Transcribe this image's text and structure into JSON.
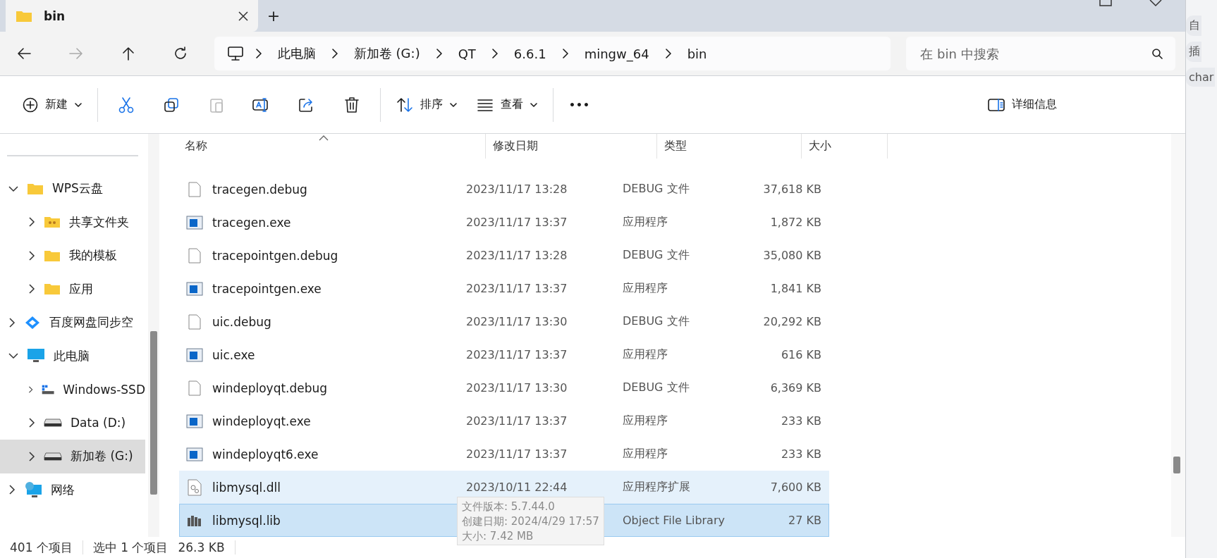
{
  "tabs": [
    {
      "title": "bin",
      "selected": true
    }
  ],
  "new_tab": "+",
  "breadcrumb": [
    "此电脑",
    "新加卷 (G:)",
    "QT",
    "6.6.1",
    "mingw_64",
    "bin"
  ],
  "search": {
    "placeholder": "在 bin 中搜索"
  },
  "toolbar": {
    "new": "新建",
    "sort": "排序",
    "view": "查看",
    "more": "•••",
    "details": "详细信息"
  },
  "sidebar": {
    "items": [
      {
        "label": "WPS云盘",
        "kind": "folder",
        "expanded": true,
        "selected": false,
        "children": [
          {
            "label": "共享文件夹",
            "kind": "shared",
            "expanded": false,
            "selected": false
          },
          {
            "label": "我的模板",
            "kind": "folder",
            "expanded": false,
            "selected": false
          },
          {
            "label": "应用",
            "kind": "folder",
            "expanded": false,
            "selected": false
          }
        ]
      },
      {
        "label": "百度网盘同步空",
        "kind": "cloud",
        "expanded": false,
        "selected": false
      },
      {
        "label": "此电脑",
        "kind": "pc",
        "expanded": true,
        "selected": false,
        "children": [
          {
            "label": "Windows-SSD",
            "kind": "windrive",
            "expanded": false,
            "selected": false
          },
          {
            "label": "Data (D:)",
            "kind": "drive",
            "expanded": false,
            "selected": false
          },
          {
            "label": "新加卷 (G:)",
            "kind": "drive",
            "expanded": false,
            "selected": true
          }
        ]
      },
      {
        "label": "网络",
        "kind": "network",
        "expanded": false,
        "selected": false
      }
    ]
  },
  "table": {
    "columns": [
      "名称",
      "修改日期",
      "类型",
      "大小"
    ],
    "rows": [
      {
        "name": "tracegen.debug",
        "kind": "debug",
        "date": "2023/11/17 13:28",
        "type": "DEBUG 文件",
        "size": "37,618 KB",
        "selected": false,
        "hovered": false
      },
      {
        "name": "tracegen.exe",
        "kind": "exe",
        "date": "2023/11/17 13:37",
        "type": "应用程序",
        "size": "1,872 KB",
        "selected": false,
        "hovered": false
      },
      {
        "name": "tracepointgen.debug",
        "kind": "debug",
        "date": "2023/11/17 13:28",
        "type": "DEBUG 文件",
        "size": "35,080 KB",
        "selected": false,
        "hovered": false
      },
      {
        "name": "tracepointgen.exe",
        "kind": "exe",
        "date": "2023/11/17 13:37",
        "type": "应用程序",
        "size": "1,841 KB",
        "selected": false,
        "hovered": false
      },
      {
        "name": "uic.debug",
        "kind": "debug",
        "date": "2023/11/17 13:30",
        "type": "DEBUG 文件",
        "size": "20,292 KB",
        "selected": false,
        "hovered": false
      },
      {
        "name": "uic.exe",
        "kind": "exe",
        "date": "2023/11/17 13:37",
        "type": "应用程序",
        "size": "616 KB",
        "selected": false,
        "hovered": false
      },
      {
        "name": "windeployqt.debug",
        "kind": "debug",
        "date": "2023/11/17 13:30",
        "type": "DEBUG 文件",
        "size": "6,369 KB",
        "selected": false,
        "hovered": false
      },
      {
        "name": "windeployqt.exe",
        "kind": "exe",
        "date": "2023/11/17 13:37",
        "type": "应用程序",
        "size": "233 KB",
        "selected": false,
        "hovered": false
      },
      {
        "name": "windeployqt6.exe",
        "kind": "exe",
        "date": "2023/11/17 13:37",
        "type": "应用程序",
        "size": "233 KB",
        "selected": false,
        "hovered": false
      },
      {
        "name": "libmysql.dll",
        "kind": "dll",
        "date": "2023/10/11 22:44",
        "type": "应用程序扩展",
        "size": "7,600 KB",
        "selected": false,
        "hovered": true
      },
      {
        "name": "libmysql.lib",
        "kind": "lib",
        "type": "Object File Library",
        "size": "27 KB",
        "selected": true,
        "hovered": false
      }
    ]
  },
  "tooltip": [
    "文件版本: 5.7.44.0",
    "创建日期: 2024/4/29 17:57",
    "大小: 7.42 MB"
  ],
  "status_bar": {
    "count": "401 个项目",
    "selection": "选中 1 个项目",
    "selection_size": "26.3 KB"
  },
  "background_window": {
    "texts": [
      "自",
      "插",
      "char"
    ]
  }
}
